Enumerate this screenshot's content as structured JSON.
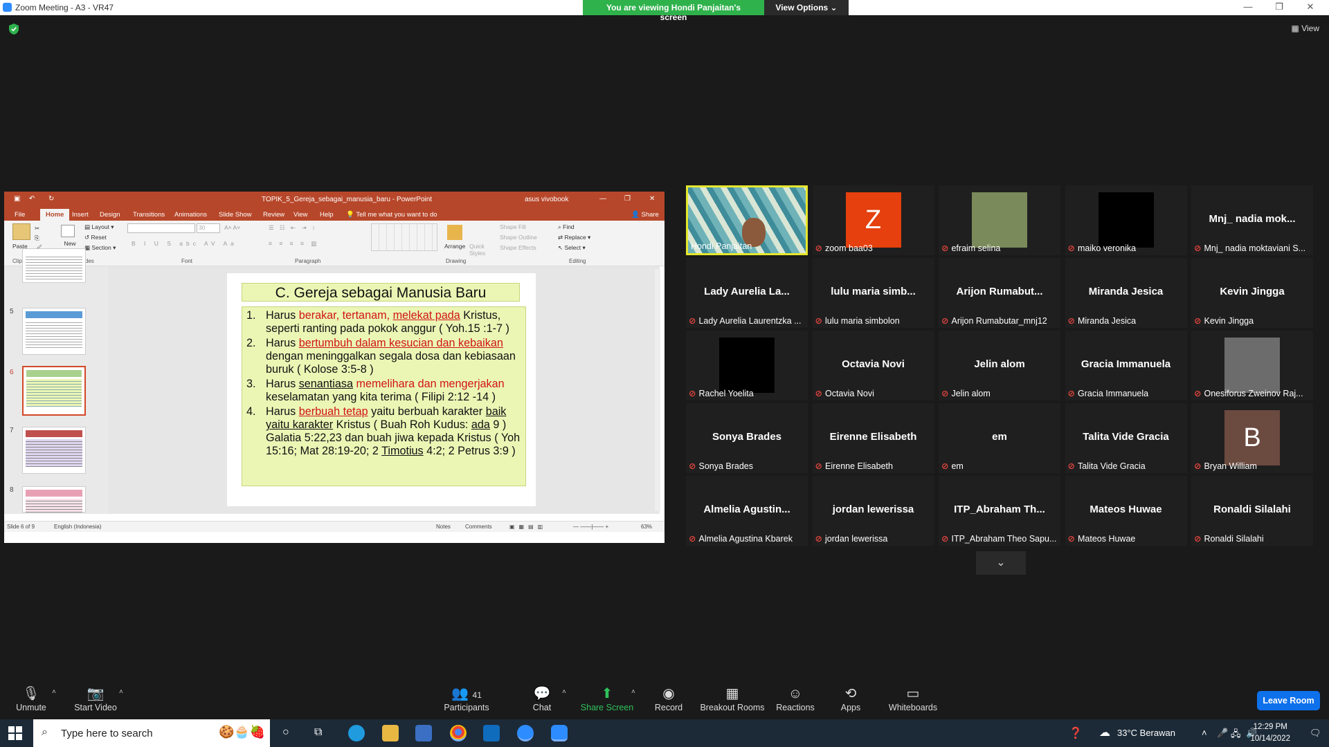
{
  "window": {
    "title": "Zoom Meeting - A3 - VR47",
    "minimize": "—",
    "maximize": "❐",
    "close": "✕"
  },
  "banner": {
    "viewing": "You are viewing Hondi Panjaitan's screen",
    "view_options": "View Options"
  },
  "view_label": "View",
  "powerpoint": {
    "file_name": "TOPIK_5_Gereja_sebagai_manusia_baru - PowerPoint",
    "user": "asus vivobook",
    "tabs": [
      "File",
      "Home",
      "Insert",
      "Design",
      "Transitions",
      "Animations",
      "Slide Show",
      "Review",
      "View",
      "Help"
    ],
    "tell_me": "Tell me what you want to do",
    "share": "Share",
    "ribbon": {
      "paste": "Paste",
      "new_slide": "New Slide",
      "layout": "Layout",
      "reset": "Reset",
      "section": "Section",
      "font_size": "30",
      "arrange": "Arrange",
      "quick_styles": "Quick Styles",
      "shape_fill": "Shape Fill",
      "shape_outline": "Shape Outline",
      "shape_effects": "Shape Effects",
      "find": "Find",
      "replace": "Replace",
      "select": "Select",
      "groups": [
        "Clipboard",
        "Slides",
        "Font",
        "Paragraph",
        "Drawing",
        "Editing"
      ]
    },
    "thumbnails": [
      {
        "num": "5",
        "title_color": "#5b9bd5"
      },
      {
        "num": "6",
        "title_color": "#a9d18e"
      },
      {
        "num": "7",
        "title_color": "#c0504d"
      },
      {
        "num": "8",
        "title_color": "#e8a0b4"
      }
    ],
    "slide": {
      "title": "C. Gereja sebagai Manusia Baru",
      "items": [
        {
          "num": "1.",
          "parts": [
            "Harus ",
            "berakar, tertanam, ",
            "melekat pada",
            " Kristus, seperti ranting pada pokok anggur ( Yoh.15 :1-7 )"
          ]
        },
        {
          "num": "2.",
          "parts": [
            "Harus ",
            "bertumbuh dalam kesucian dan kebaikan",
            " dengan meninggalkan segala dosa dan kebiasaan buruk ( Kolose 3:5-8 )"
          ]
        },
        {
          "num": "3.",
          "parts": [
            "Harus ",
            "senantiasa",
            " ",
            "memelihara dan mengerjakan",
            " keselamatan yang kita terima ( Filipi 2:12 -14 )"
          ]
        },
        {
          "num": "4.",
          "parts": [
            "Harus ",
            "berbuah tetap",
            " yaitu berbuah karakter ",
            "baik yaitu karakter",
            " Kristus  ( Buah Roh Kudus: ",
            "ada",
            " 9 ) Galatia 5:22,23 dan buah jiwa kepada Kristus ( Yoh 15:16; Mat 28:19-20; 2 ",
            "Timotius",
            " 4:2; 2 Petrus 3:9 )"
          ]
        }
      ]
    },
    "status": {
      "slide_of": "Slide 6 of 9",
      "language": "English (Indonesia)",
      "notes": "Notes",
      "comments": "Comments",
      "zoom": "63%"
    }
  },
  "participants": [
    {
      "big": "",
      "name": "Hondi Panjaitan",
      "muted": false,
      "type": "video"
    },
    {
      "big": "",
      "name": "zoom baa03",
      "muted": true,
      "type": "letter",
      "letter": "Z",
      "color": "#e5400e"
    },
    {
      "big": "",
      "name": "efraim selina",
      "muted": true,
      "type": "photo",
      "color": "#7a8a5a"
    },
    {
      "big": "",
      "name": "maiko veronika",
      "muted": true,
      "type": "photo",
      "color": "#000000"
    },
    {
      "big": "Mnj_ nadia mok...",
      "name": "Mnj_ nadia moktaviani S...",
      "muted": true,
      "type": "name"
    },
    {
      "big": "Lady Aurelia La...",
      "name": "Lady Aurelia Laurentzka ...",
      "muted": true,
      "type": "name"
    },
    {
      "big": "lulu maria simb...",
      "name": "lulu maria simbolon",
      "muted": true,
      "type": "name"
    },
    {
      "big": "Arijon  Rumabut...",
      "name": "Arijon Rumabutar_mnj12",
      "muted": true,
      "type": "name"
    },
    {
      "big": "Miranda Jesica",
      "name": "Miranda Jesica",
      "muted": true,
      "type": "name"
    },
    {
      "big": "Kevin Jingga",
      "name": "Kevin Jingga",
      "muted": true,
      "type": "name"
    },
    {
      "big": "",
      "name": "Rachel Yoelita",
      "muted": true,
      "type": "photo",
      "color": "#000000"
    },
    {
      "big": "Octavia Novi",
      "name": "Octavia Novi",
      "muted": true,
      "type": "name"
    },
    {
      "big": "Jelin alom",
      "name": "Jelin alom",
      "muted": true,
      "type": "name"
    },
    {
      "big": "Gracia Immanuela",
      "name": "Gracia Immanuela",
      "muted": true,
      "type": "name"
    },
    {
      "big": "",
      "name": "Onesiforus Zweinov Raj...",
      "muted": true,
      "type": "photo",
      "color": "#6c6c6c"
    },
    {
      "big": "Sonya Brades",
      "name": "Sonya Brades",
      "muted": true,
      "type": "name"
    },
    {
      "big": "Eirenne Elisabeth",
      "name": "Eirenne Elisabeth",
      "muted": true,
      "type": "name"
    },
    {
      "big": "em",
      "name": "em",
      "muted": true,
      "type": "name"
    },
    {
      "big": "Talita Vide Gracia",
      "name": "Talita Vide Gracia",
      "muted": true,
      "type": "name"
    },
    {
      "big": "",
      "name": "Bryan William",
      "muted": true,
      "type": "letter",
      "letter": "B",
      "color": "#6b4a40"
    },
    {
      "big": "Almelia  Agustin...",
      "name": "Almelia Agustina Kbarek",
      "muted": true,
      "type": "name"
    },
    {
      "big": "jordan lewerissa",
      "name": "jordan lewerissa",
      "muted": true,
      "type": "name"
    },
    {
      "big": "ITP_Abraham  Th...",
      "name": "ITP_Abraham Theo Sapu...",
      "muted": true,
      "type": "name"
    },
    {
      "big": "Mateos Huwae",
      "name": "Mateos Huwae",
      "muted": true,
      "type": "name"
    },
    {
      "big": "Ronaldi Silalahi",
      "name": "Ronaldi Silalahi",
      "muted": true,
      "type": "name"
    }
  ],
  "toolbar": {
    "unmute": "Unmute",
    "start_video": "Start Video",
    "participants": "Participants",
    "participants_count": "41",
    "chat": "Chat",
    "share_screen": "Share Screen",
    "record": "Record",
    "breakout": "Breakout Rooms",
    "reactions": "Reactions",
    "apps": "Apps",
    "whiteboards": "Whiteboards",
    "leave": "Leave Room"
  },
  "taskbar": {
    "search_placeholder": "Type here to search",
    "weather": "33°C  Berawan",
    "time": "12:29 PM",
    "date": "10/14/2022"
  }
}
